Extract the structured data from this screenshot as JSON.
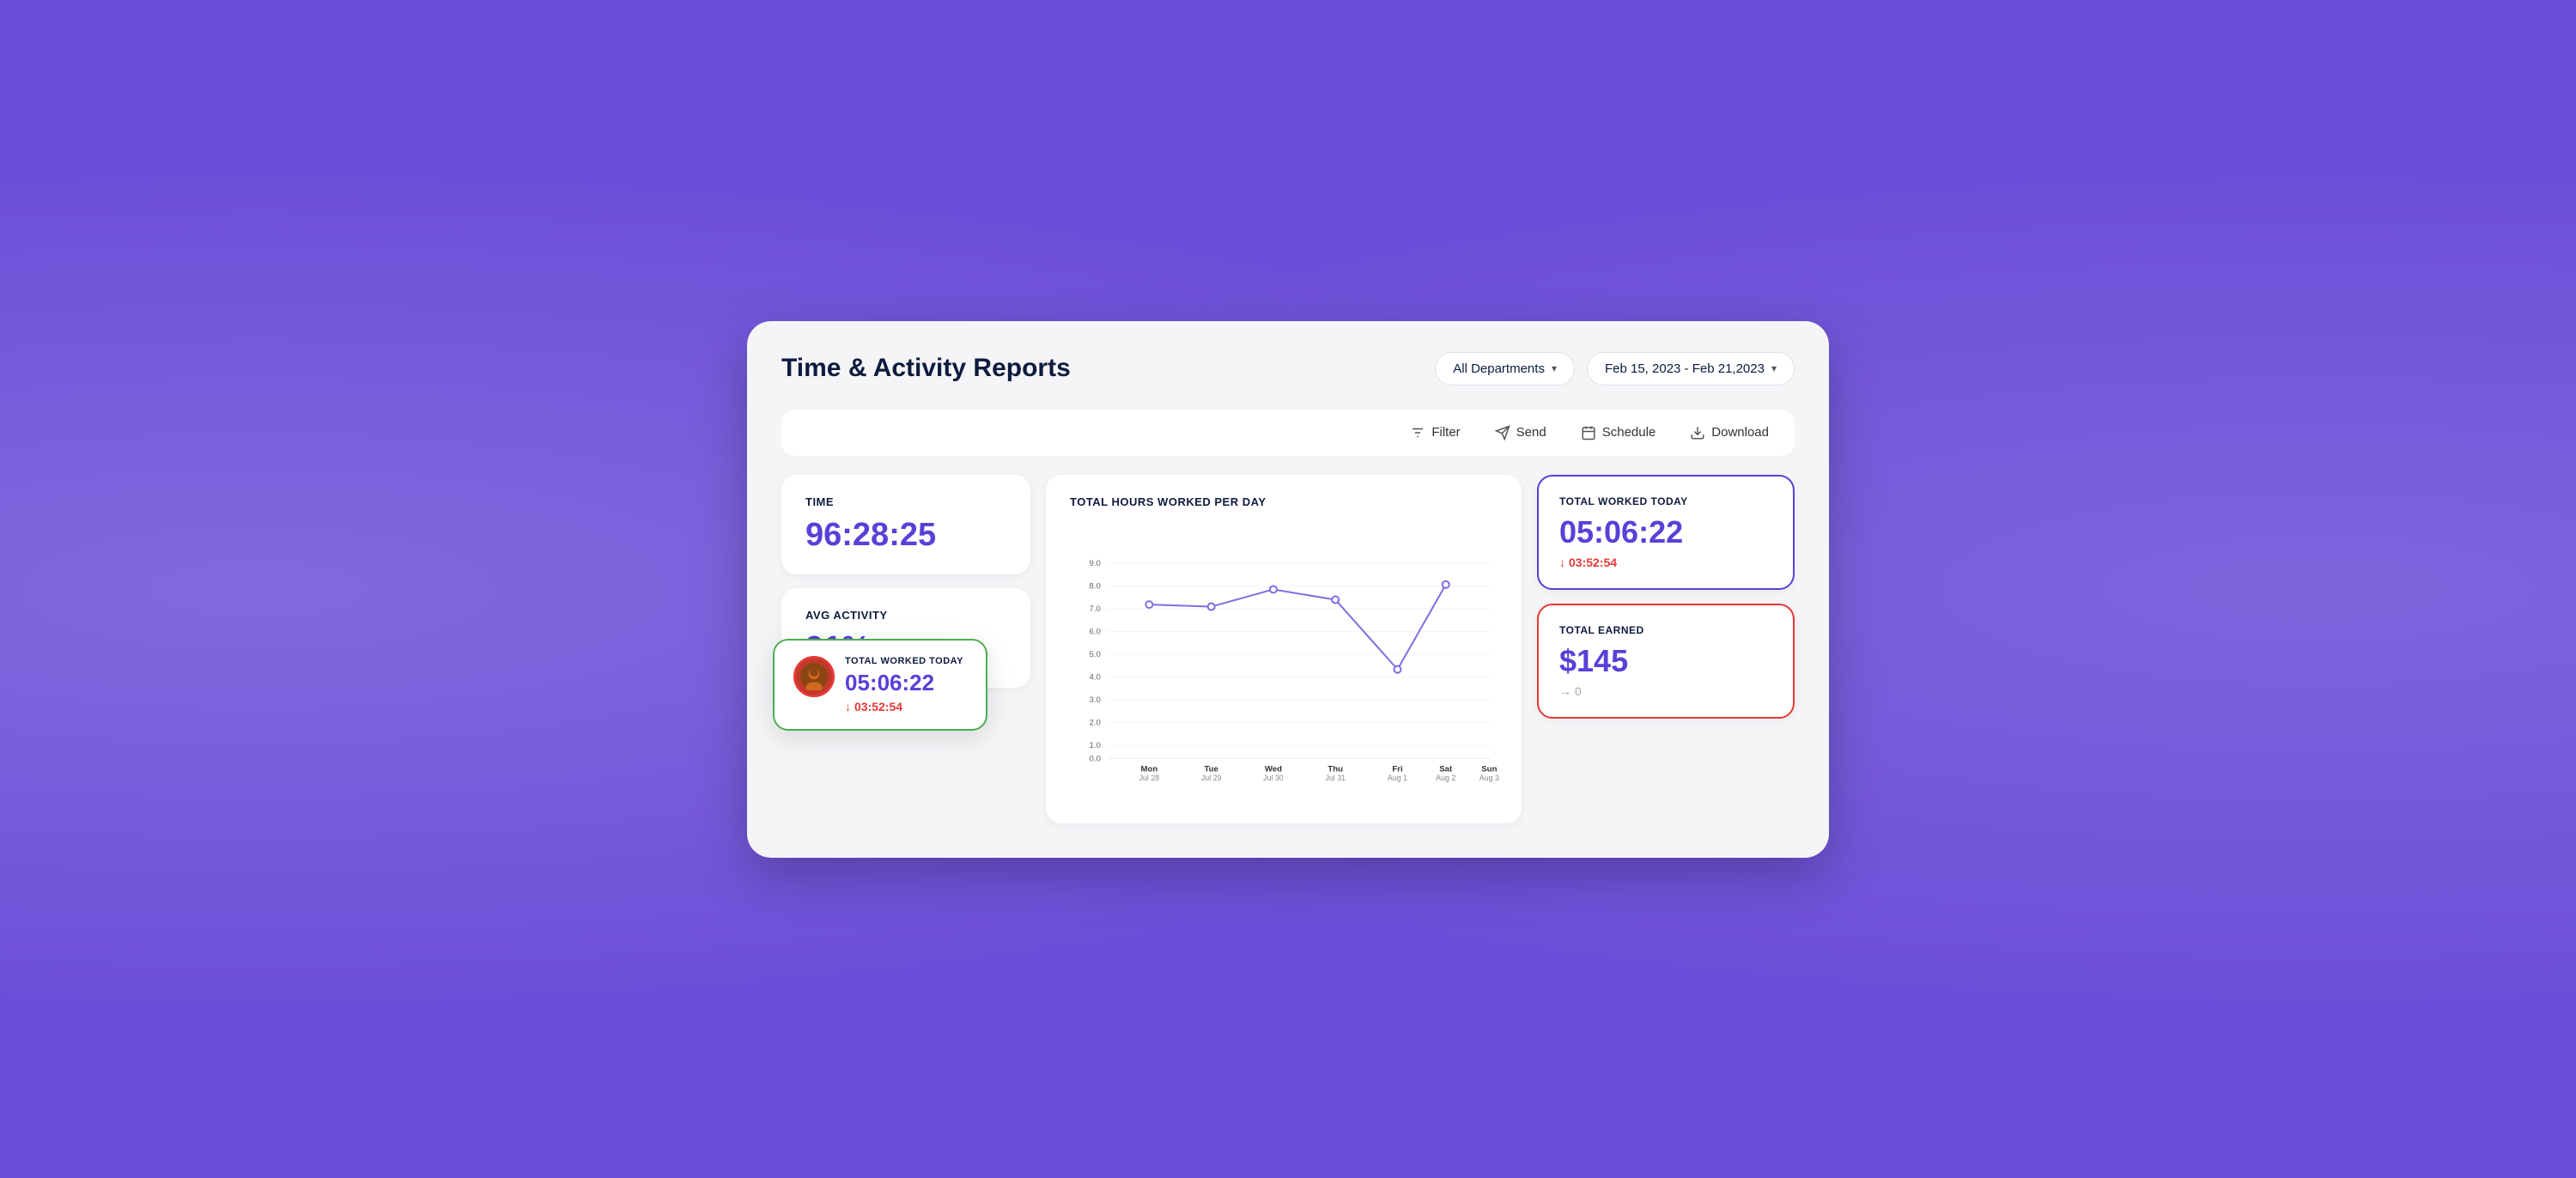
{
  "header": {
    "title": "Time & Activity Reports",
    "department_label": "All Departments",
    "date_range": "Feb 15, 2023 - Feb 21,2023"
  },
  "toolbar": {
    "filter_label": "Filter",
    "send_label": "Send",
    "schedule_label": "Schedule",
    "download_label": "Download"
  },
  "stats": {
    "time_label": "TIME",
    "time_value": "96:28:25",
    "avg_activity_label": "AVG ACTIVITY",
    "avg_activity_value": "91%"
  },
  "chart": {
    "title": "TOTAL HOURS WORKED PER DAY",
    "y_axis": [
      "9.0",
      "8.0",
      "7.0",
      "6.0",
      "5.0",
      "4.0",
      "3.0",
      "2.0",
      "1.0",
      "0.0"
    ],
    "x_axis": [
      {
        "main": "Mon",
        "sub": "Jul 28"
      },
      {
        "main": "Tue",
        "sub": "Jul 29"
      },
      {
        "main": "Wed",
        "sub": "Jul 30"
      },
      {
        "main": "Thu",
        "sub": "Jul 31"
      },
      {
        "main": "Fri",
        "sub": "Aug 1"
      },
      {
        "main": "Sat",
        "sub": "Aug 2"
      },
      {
        "main": "Sun",
        "sub": "Aug 3"
      }
    ],
    "data_points": [
      7.1,
      7.0,
      7.8,
      7.3,
      4.1,
      8.0
    ]
  },
  "right_cards": {
    "total_worked_label": "TOTAL WORKED TODAY",
    "total_worked_value": "05:06:22",
    "total_worked_delta": "03:52:54",
    "total_earned_label": "TOTAL EARNED",
    "total_earned_value": "$145",
    "total_earned_delta": "0"
  },
  "floating_card": {
    "label": "TOTAL WORKED TODAY",
    "value": "05:06:22",
    "delta": "03:52:54"
  }
}
